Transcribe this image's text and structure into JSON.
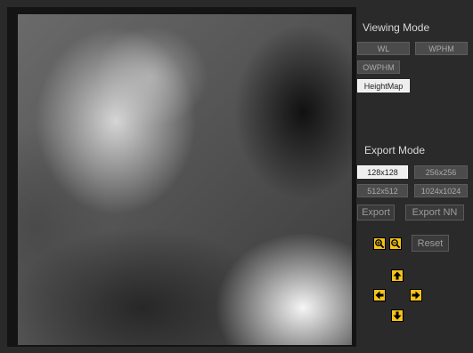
{
  "viewing_mode": {
    "title": "Viewing Mode",
    "buttons": [
      "WL",
      "WPHM",
      "OWPHM",
      "HeightMap"
    ],
    "selected": "HeightMap"
  },
  "export_mode": {
    "title": "Export Mode",
    "sizes": [
      "128x128",
      "256x256",
      "512x512",
      "1024x1024"
    ],
    "selected_size": "128x128",
    "export_label": "Export",
    "export_nn_label": "Export NN"
  },
  "view_controls": {
    "reset_label": "Reset",
    "icons": [
      "zoom-in-icon",
      "zoom-out-icon",
      "arrow-up-icon",
      "arrow-left-icon",
      "arrow-right-icon",
      "arrow-down-icon"
    ]
  },
  "colors": {
    "background": "#2a2a2a",
    "panel": "#141414",
    "button": "#4b4b4b",
    "button_active": "#eeeeee",
    "icon_accent": "#f3c317"
  }
}
